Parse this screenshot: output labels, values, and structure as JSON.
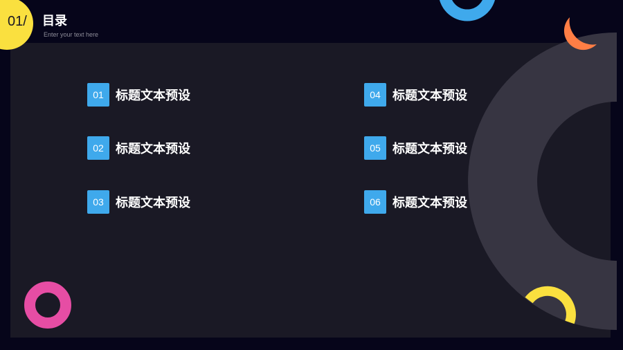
{
  "header": {
    "page_number": "01/",
    "title": "目录",
    "subtitle": "Enter your text here"
  },
  "toc": {
    "items": [
      {
        "num": "01",
        "label": "标题文本预设"
      },
      {
        "num": "02",
        "label": "标题文本预设"
      },
      {
        "num": "03",
        "label": "标题文本预设"
      },
      {
        "num": "04",
        "label": "标题文本预设"
      },
      {
        "num": "05",
        "label": "标题文本预设"
      },
      {
        "num": "06",
        "label": "标题文本预设"
      }
    ]
  },
  "colors": {
    "background": "#06051a",
    "panel": "#1a1925",
    "accent_blue": "#3fa9ec",
    "accent_yellow": "#fae03f",
    "accent_orange": "#ff7e45",
    "accent_pink": "#e64da4",
    "arc_gray": "#373542"
  },
  "decorations": [
    "blue-ring-top-icon",
    "orange-crescent-icon",
    "gray-arc-icon",
    "yellow-arc-icon",
    "pink-ring-icon"
  ]
}
